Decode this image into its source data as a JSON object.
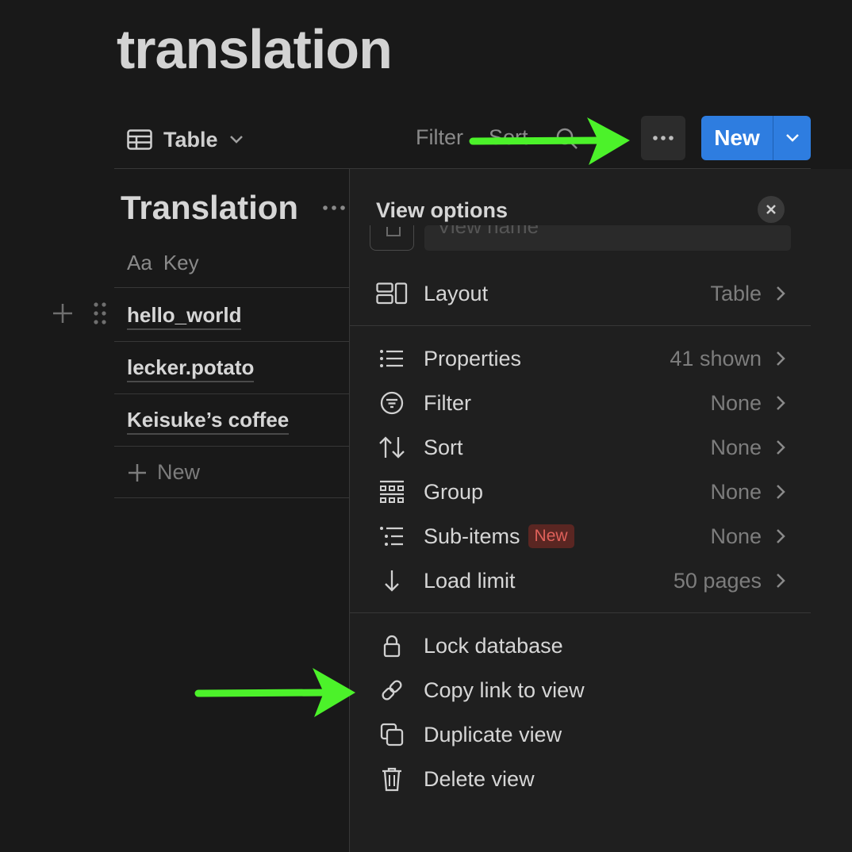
{
  "page": {
    "title": "translation"
  },
  "toolbar": {
    "view_label": "Table",
    "filter_label": "Filter",
    "sort_label": "Sort",
    "new_label": "New",
    "accent": "#2e7de0"
  },
  "table": {
    "title": "Translation",
    "column_header": {
      "icon_text": "Aa",
      "label": "Key"
    },
    "rows": [
      "hello_world",
      "lecker.potato",
      "Keisuke’s coffee"
    ],
    "add_row_label": "New"
  },
  "panel": {
    "title": "View options",
    "name_placeholder": "View name",
    "layout": {
      "label": "Layout",
      "value": "Table"
    },
    "settings": [
      {
        "label": "Properties",
        "value": "41 shown"
      },
      {
        "label": "Filter",
        "value": "None"
      },
      {
        "label": "Sort",
        "value": "None"
      },
      {
        "label": "Group",
        "value": "None"
      },
      {
        "label": "Sub-items",
        "value": "None",
        "badge": "New"
      },
      {
        "label": "Load limit",
        "value": "50 pages"
      }
    ],
    "actions": [
      {
        "label": "Lock database"
      },
      {
        "label": "Copy link to view"
      },
      {
        "label": "Duplicate view"
      },
      {
        "label": "Delete view"
      }
    ]
  },
  "annotations": {
    "arrow_color": "#4cf22a"
  }
}
